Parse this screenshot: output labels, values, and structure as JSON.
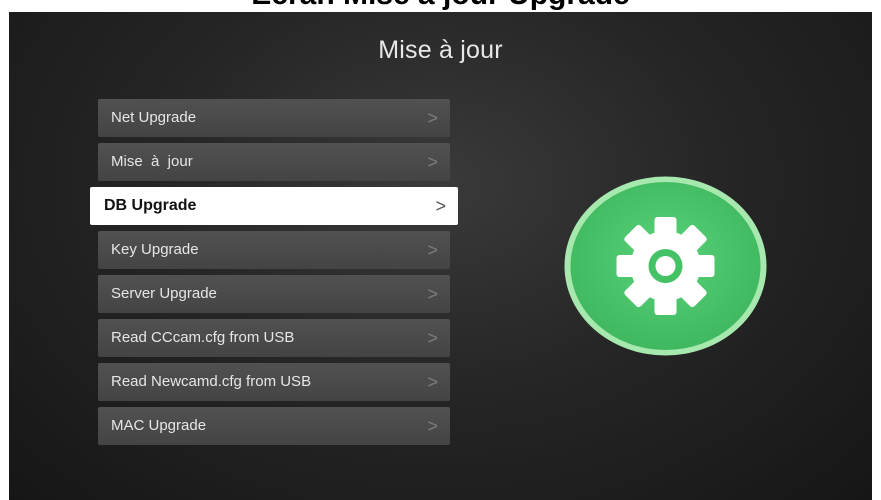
{
  "caption": {
    "text": "Écran Mise à jour Upgrade"
  },
  "screen": {
    "title": "Mise à jour"
  },
  "menu": {
    "items": [
      {
        "label": "Net Upgrade",
        "chevron": ">",
        "selected": false
      },
      {
        "label": "Mise  à  jour",
        "chevron": ">",
        "selected": false
      },
      {
        "label": "DB Upgrade",
        "chevron": ">",
        "selected": true
      },
      {
        "label": "Key Upgrade",
        "chevron": ">",
        "selected": false
      },
      {
        "label": "Server Upgrade",
        "chevron": ">",
        "selected": false
      },
      {
        "label": "Read CCcam.cfg from USB",
        "chevron": ">",
        "selected": false
      },
      {
        "label": "Read Newcamd.cfg from USB",
        "chevron": ">",
        "selected": false
      },
      {
        "label": "MAC Upgrade",
        "chevron": ">",
        "selected": false
      }
    ]
  },
  "badge": {
    "icon": "gear-icon",
    "colors": {
      "ring": "#9de3a6",
      "fill": "#4cc46c",
      "gear": "#ffffff",
      "hole": "#4cc46c"
    }
  }
}
